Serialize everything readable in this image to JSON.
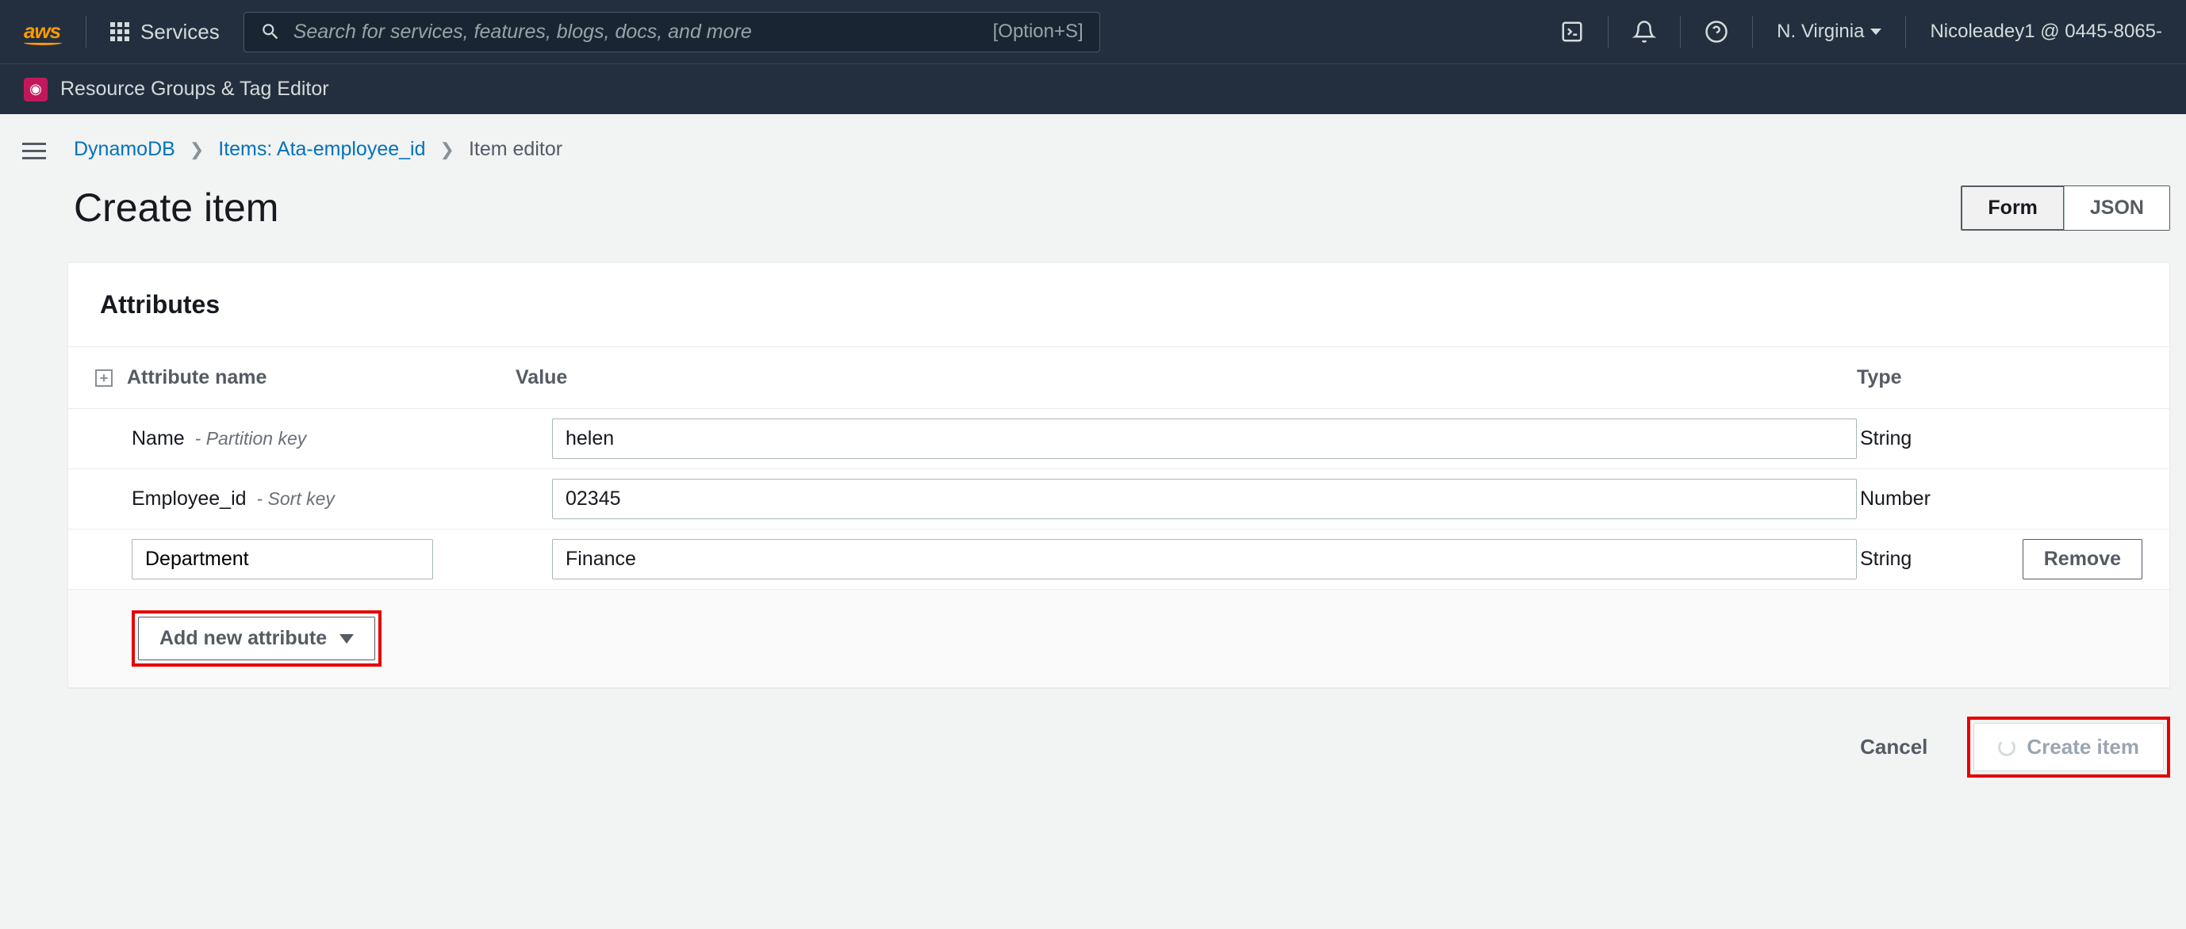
{
  "topnav": {
    "logo": "aws",
    "services": "Services",
    "search_placeholder": "Search for services, features, blogs, docs, and more",
    "search_shortcut": "[Option+S]",
    "region": "N. Virginia",
    "account": "Nicoleadey1 @ 0445-8065-"
  },
  "subnav": {
    "label": "Resource Groups & Tag Editor"
  },
  "breadcrumb": {
    "root": "DynamoDB",
    "items": "Items: Ata-employee_id",
    "current": "Item editor"
  },
  "page": {
    "title": "Create item",
    "view_form": "Form",
    "view_json": "JSON"
  },
  "panel": {
    "title": "Attributes",
    "col_name": "Attribute name",
    "col_value": "Value",
    "col_type": "Type",
    "rows": [
      {
        "name": "Name",
        "hint": "- Partition key",
        "value": "helen",
        "type": "String",
        "editable_name": false,
        "removable": false
      },
      {
        "name": "Employee_id",
        "hint": "- Sort key",
        "value": "02345",
        "type": "Number",
        "editable_name": false,
        "removable": false
      },
      {
        "name": "Department",
        "hint": "",
        "value": "Finance",
        "type": "String",
        "editable_name": true,
        "removable": true
      }
    ],
    "add_attr": "Add new attribute",
    "remove": "Remove"
  },
  "footer": {
    "cancel": "Cancel",
    "create": "Create item"
  }
}
